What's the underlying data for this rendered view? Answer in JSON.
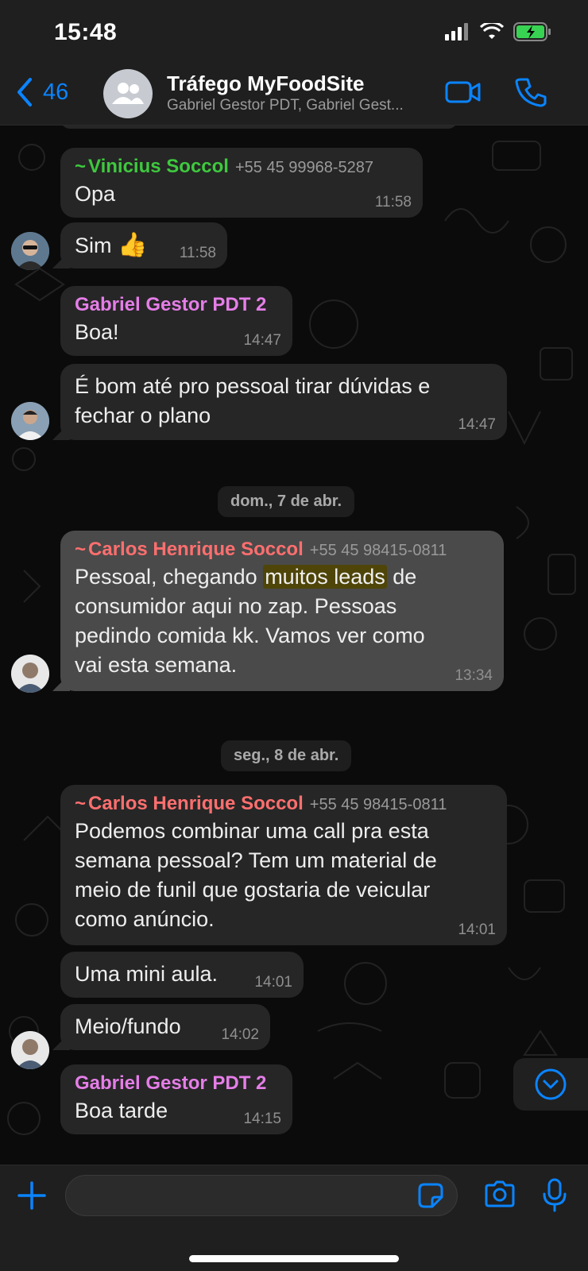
{
  "status_bar": {
    "time": "15:48"
  },
  "header": {
    "back_count": "46",
    "title": "Tráfego MyFoodSite",
    "members": "Gabriel Gestor PDT, Gabriel Gest..."
  },
  "colors": {
    "accent": "#0a84ff",
    "sender_green": "#3ec93e",
    "sender_pink": "#e57ee8",
    "sender_red": "#ff6f6f",
    "highlight": "#4f4509"
  },
  "messages": [
    {
      "sender": "Vinicius Soccol",
      "phone": "+55 45 99968-5287",
      "text": "Opa",
      "time": "11:58"
    },
    {
      "text": "Sim",
      "emoji": "👍",
      "time": "11:58"
    },
    {
      "sender": "Gabriel Gestor PDT 2",
      "text": "Boa!",
      "time": "14:47"
    },
    {
      "line1": "É bom até pro pessoal tirar dúvidas e",
      "line2": "fechar o plano",
      "time": "14:47"
    },
    {
      "sender": "Carlos Henrique Soccol",
      "phone": "+55 45 98415-0811",
      "before": "Pessoal, chegando ",
      "highlight": "muitos leads",
      "after": " de",
      "line2": "consumidor aqui no zap. Pessoas",
      "line3": "pedindo comida kk. Vamos ver como",
      "line4": "vai esta semana.",
      "time": "13:34"
    },
    {
      "sender": "Carlos Henrique Soccol",
      "phone": "+55 45 98415-0811",
      "line1": "Podemos combinar uma call pra esta",
      "line2": "semana pessoal? Tem um material de",
      "line3": "meio de funil que gostaria de veicular",
      "line4": "como anúncio.",
      "time": "14:01"
    },
    {
      "text": "Uma mini aula.",
      "time": "14:01"
    },
    {
      "text": "Meio/fundo",
      "time": "14:02"
    },
    {
      "sender": "Gabriel Gestor PDT 2",
      "text": "Boa tarde",
      "time": "14:15"
    }
  ],
  "date_separators": [
    "dom., 7 de abr.",
    "seg., 8 de abr."
  ],
  "icons": {
    "back": "chevron-left-icon",
    "group": "group-avatar-icon",
    "video": "video-call-icon",
    "call": "phone-icon",
    "scroll": "chevron-down-circle-icon",
    "plus": "plus-icon",
    "sticker": "sticker-icon",
    "camera": "camera-icon",
    "mic": "microphone-icon"
  },
  "composer": {
    "placeholder": ""
  }
}
